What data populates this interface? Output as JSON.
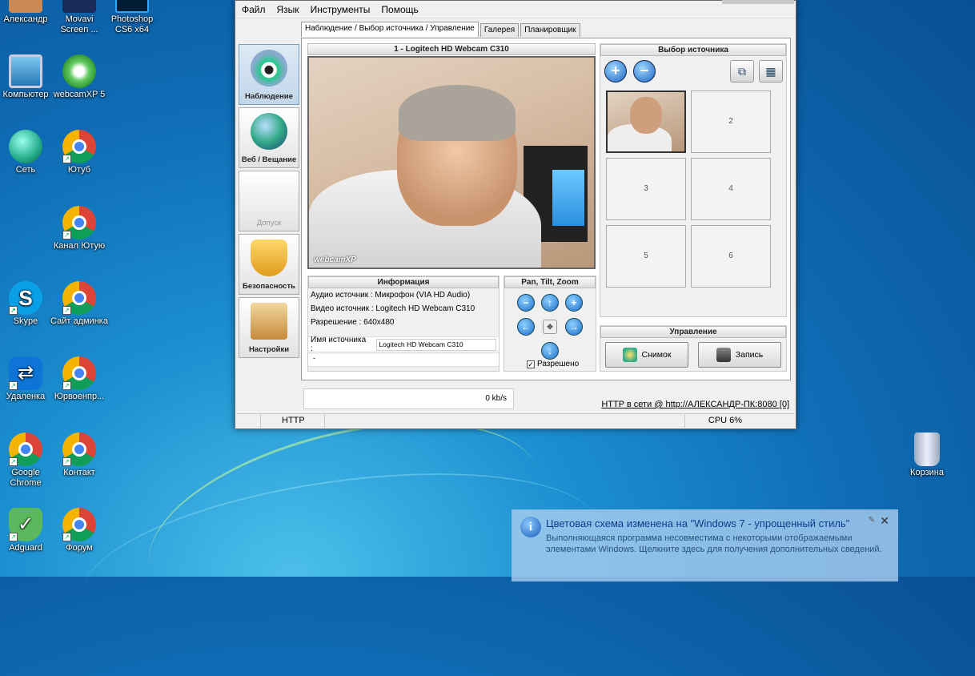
{
  "desktop": {
    "icons": [
      {
        "label": "Александр",
        "icon": "user-folder-icon"
      },
      {
        "label": "Movavi Screen ...",
        "icon": "movavi-icon"
      },
      {
        "label": "Photoshop CS6 x64",
        "icon": "photoshop-icon"
      },
      {
        "label": "Компьютер",
        "icon": "computer-icon"
      },
      {
        "label": "webcamXP 5",
        "icon": "webcamxp-icon"
      },
      {
        "label": "Сеть",
        "icon": "network-icon"
      },
      {
        "label": "Ютуб",
        "icon": "chrome-icon"
      },
      {
        "label": "Канал Ютую",
        "icon": "chrome-icon"
      },
      {
        "label": "Skype",
        "icon": "skype-icon"
      },
      {
        "label": "Сайт админка",
        "icon": "chrome-icon"
      },
      {
        "label": "Удаленка",
        "icon": "teamviewer-icon"
      },
      {
        "label": "Юрвоенпр...",
        "icon": "chrome-icon"
      },
      {
        "label": "Google Chrome",
        "icon": "chrome-icon"
      },
      {
        "label": "Контакт",
        "icon": "chrome-icon"
      },
      {
        "label": "Adguard",
        "icon": "adguard-icon"
      },
      {
        "label": "Форум",
        "icon": "chrome-icon"
      },
      {
        "label": "Корзина",
        "icon": "recycle-bin-icon"
      }
    ]
  },
  "app": {
    "menu": [
      "Файл",
      "Язык",
      "Инструменты",
      "Помощь"
    ],
    "nav": [
      {
        "label": "Наблюдение",
        "icon": "eye-icon"
      },
      {
        "label": "Веб / Вещание",
        "icon": "globe-icon"
      },
      {
        "label": "Допуск",
        "icon": "access-icon"
      },
      {
        "label": "Безопасность",
        "icon": "shield-icon"
      },
      {
        "label": "Настройки",
        "icon": "settings-icon"
      }
    ],
    "tabs": [
      "Наблюдение / Выбор источника / Управление",
      "Галерея",
      "Планировщик"
    ],
    "video": {
      "title": "1 - Logitech HD Webcam C310",
      "watermark": "webcamXP"
    },
    "info": {
      "title": "Информация",
      "audio": "Аудио источник : Микрофон (VIA HD Audio)",
      "video": "Видео источник : Logitech HD Webcam C310",
      "resolution": "Разрешение : 640x480",
      "name_label": "Имя источника :",
      "name_value": "Logitech HD Webcam C310",
      "extra": "-"
    },
    "ptz": {
      "title": "Pan, Tilt, Zoom",
      "enabled_label": "Разрешено",
      "enabled": true
    },
    "sources": {
      "title": "Выбор источника",
      "slots": [
        "2",
        "3",
        "4",
        "5",
        "6"
      ]
    },
    "control": {
      "title": "Управление",
      "snapshot": "Снимок",
      "record": "Запись"
    },
    "speed": "0 kb/s",
    "http_link": "HTTP в сети @ http://АЛЕКСАНДР-ПК:8080 [0]",
    "status": {
      "protocol": "HTTP",
      "cpu": "CPU 6%"
    }
  },
  "notification": {
    "title": "Цветовая схема изменена на \"Windows 7 - упрощенный стиль\"",
    "body": "Выполняющаяся программа несовместима с некоторыми отображаемыми элементами Windows.  Щелкните здесь для получения дополнительных сведений."
  }
}
